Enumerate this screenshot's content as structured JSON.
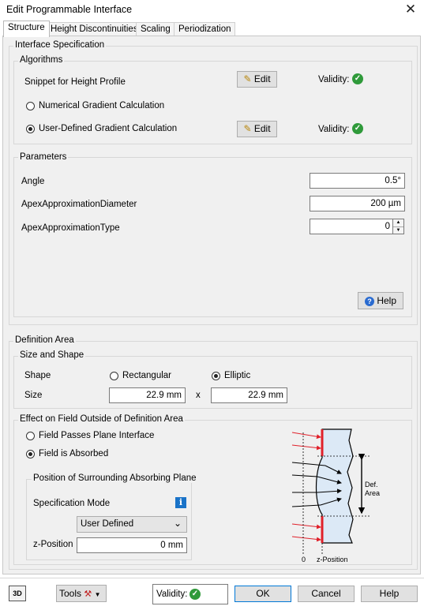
{
  "window": {
    "title": "Edit Programmable Interface"
  },
  "tabs": [
    "Structure",
    "Height Discontinuities",
    "Scaling",
    "Periodization"
  ],
  "interface_spec": {
    "title": "Interface Specification",
    "algorithms": {
      "title": "Algorithms",
      "snippet_label": "Snippet for Height Profile",
      "numerical_label": "Numerical Gradient Calculation",
      "user_defined_label": "User-Defined Gradient Calculation",
      "edit_label": "Edit",
      "validity_label": "Validity:"
    },
    "parameters": {
      "title": "Parameters",
      "items": [
        {
          "label": "Angle",
          "value": "0.5°"
        },
        {
          "label": "ApexApproximationDiameter",
          "value": "200 µm"
        },
        {
          "label": "ApexApproximationType",
          "value": "0"
        }
      ],
      "help_label": "Help"
    }
  },
  "definition_area": {
    "title": "Definition Area",
    "size_shape": {
      "title": "Size and Shape",
      "shape_label": "Shape",
      "rectangular_label": "Rectangular",
      "elliptic_label": "Elliptic",
      "size_label": "Size",
      "size_x": "22.9 mm",
      "times": "x",
      "size_y": "22.9 mm"
    },
    "effect": {
      "title": "Effect on Field Outside of Definition Area",
      "passes_label": "Field Passes Plane Interface",
      "absorbed_label": "Field is Absorbed",
      "absorbing_plane": {
        "title": "Position of Surrounding Absorbing Plane",
        "spec_mode_label": "Specification Mode",
        "spec_mode_value": "User Defined",
        "z_label": "z-Position",
        "z_value": "0 mm"
      },
      "diagram": {
        "def_label_1": "Def.",
        "def_label_2": "Area",
        "zero_label": "0",
        "z_label": "z-Position"
      }
    }
  },
  "footer": {
    "tools_label": "Tools",
    "validity_label": "Validity:",
    "ok_label": "OK",
    "cancel_label": "Cancel",
    "help_label": "Help"
  },
  "colors": {
    "validity_green": "#2f9a3a",
    "arrow_red": "#e0202a",
    "info_blue": "#1a73c8"
  }
}
